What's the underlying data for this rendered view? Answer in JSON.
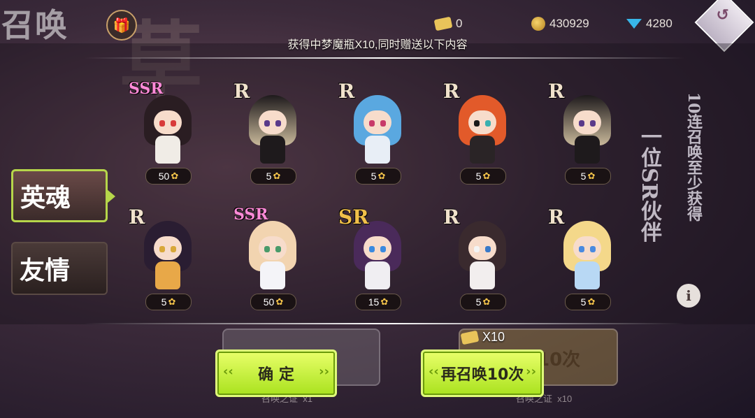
{
  "background": {
    "title": "召唤"
  },
  "topbar": {
    "tickets": "0",
    "coins": "430929",
    "gems": "4280"
  },
  "headline": "获得中梦魔瓶X10,同时赠送以下内容",
  "side_tabs": [
    {
      "label": "英魂",
      "active": true
    },
    {
      "label": "友情",
      "active": false
    }
  ],
  "promo_vertical": [
    "10连召唤至少获得",
    "一位SR伙伴"
  ],
  "cards": [
    {
      "rarity": "SSR",
      "amount": "50"
    },
    {
      "rarity": "R",
      "amount": "5"
    },
    {
      "rarity": "R",
      "amount": "5"
    },
    {
      "rarity": "R",
      "amount": "5"
    },
    {
      "rarity": "R",
      "amount": "5"
    },
    {
      "rarity": "R",
      "amount": "5"
    },
    {
      "rarity": "SSR",
      "amount": "50"
    },
    {
      "rarity": "SR",
      "amount": "15"
    },
    {
      "rarity": "R",
      "amount": "5"
    },
    {
      "rarity": "R",
      "amount": "5"
    }
  ],
  "buttons": {
    "confirm": "确 定",
    "summon_again": "再召唤10次",
    "cost_multiplier": "X10"
  },
  "ghost": {
    "left_caption": "召唤之证",
    "left_count": "x1",
    "right_caption": "召唤之证",
    "right_count": "x10",
    "right_label": "10次"
  }
}
